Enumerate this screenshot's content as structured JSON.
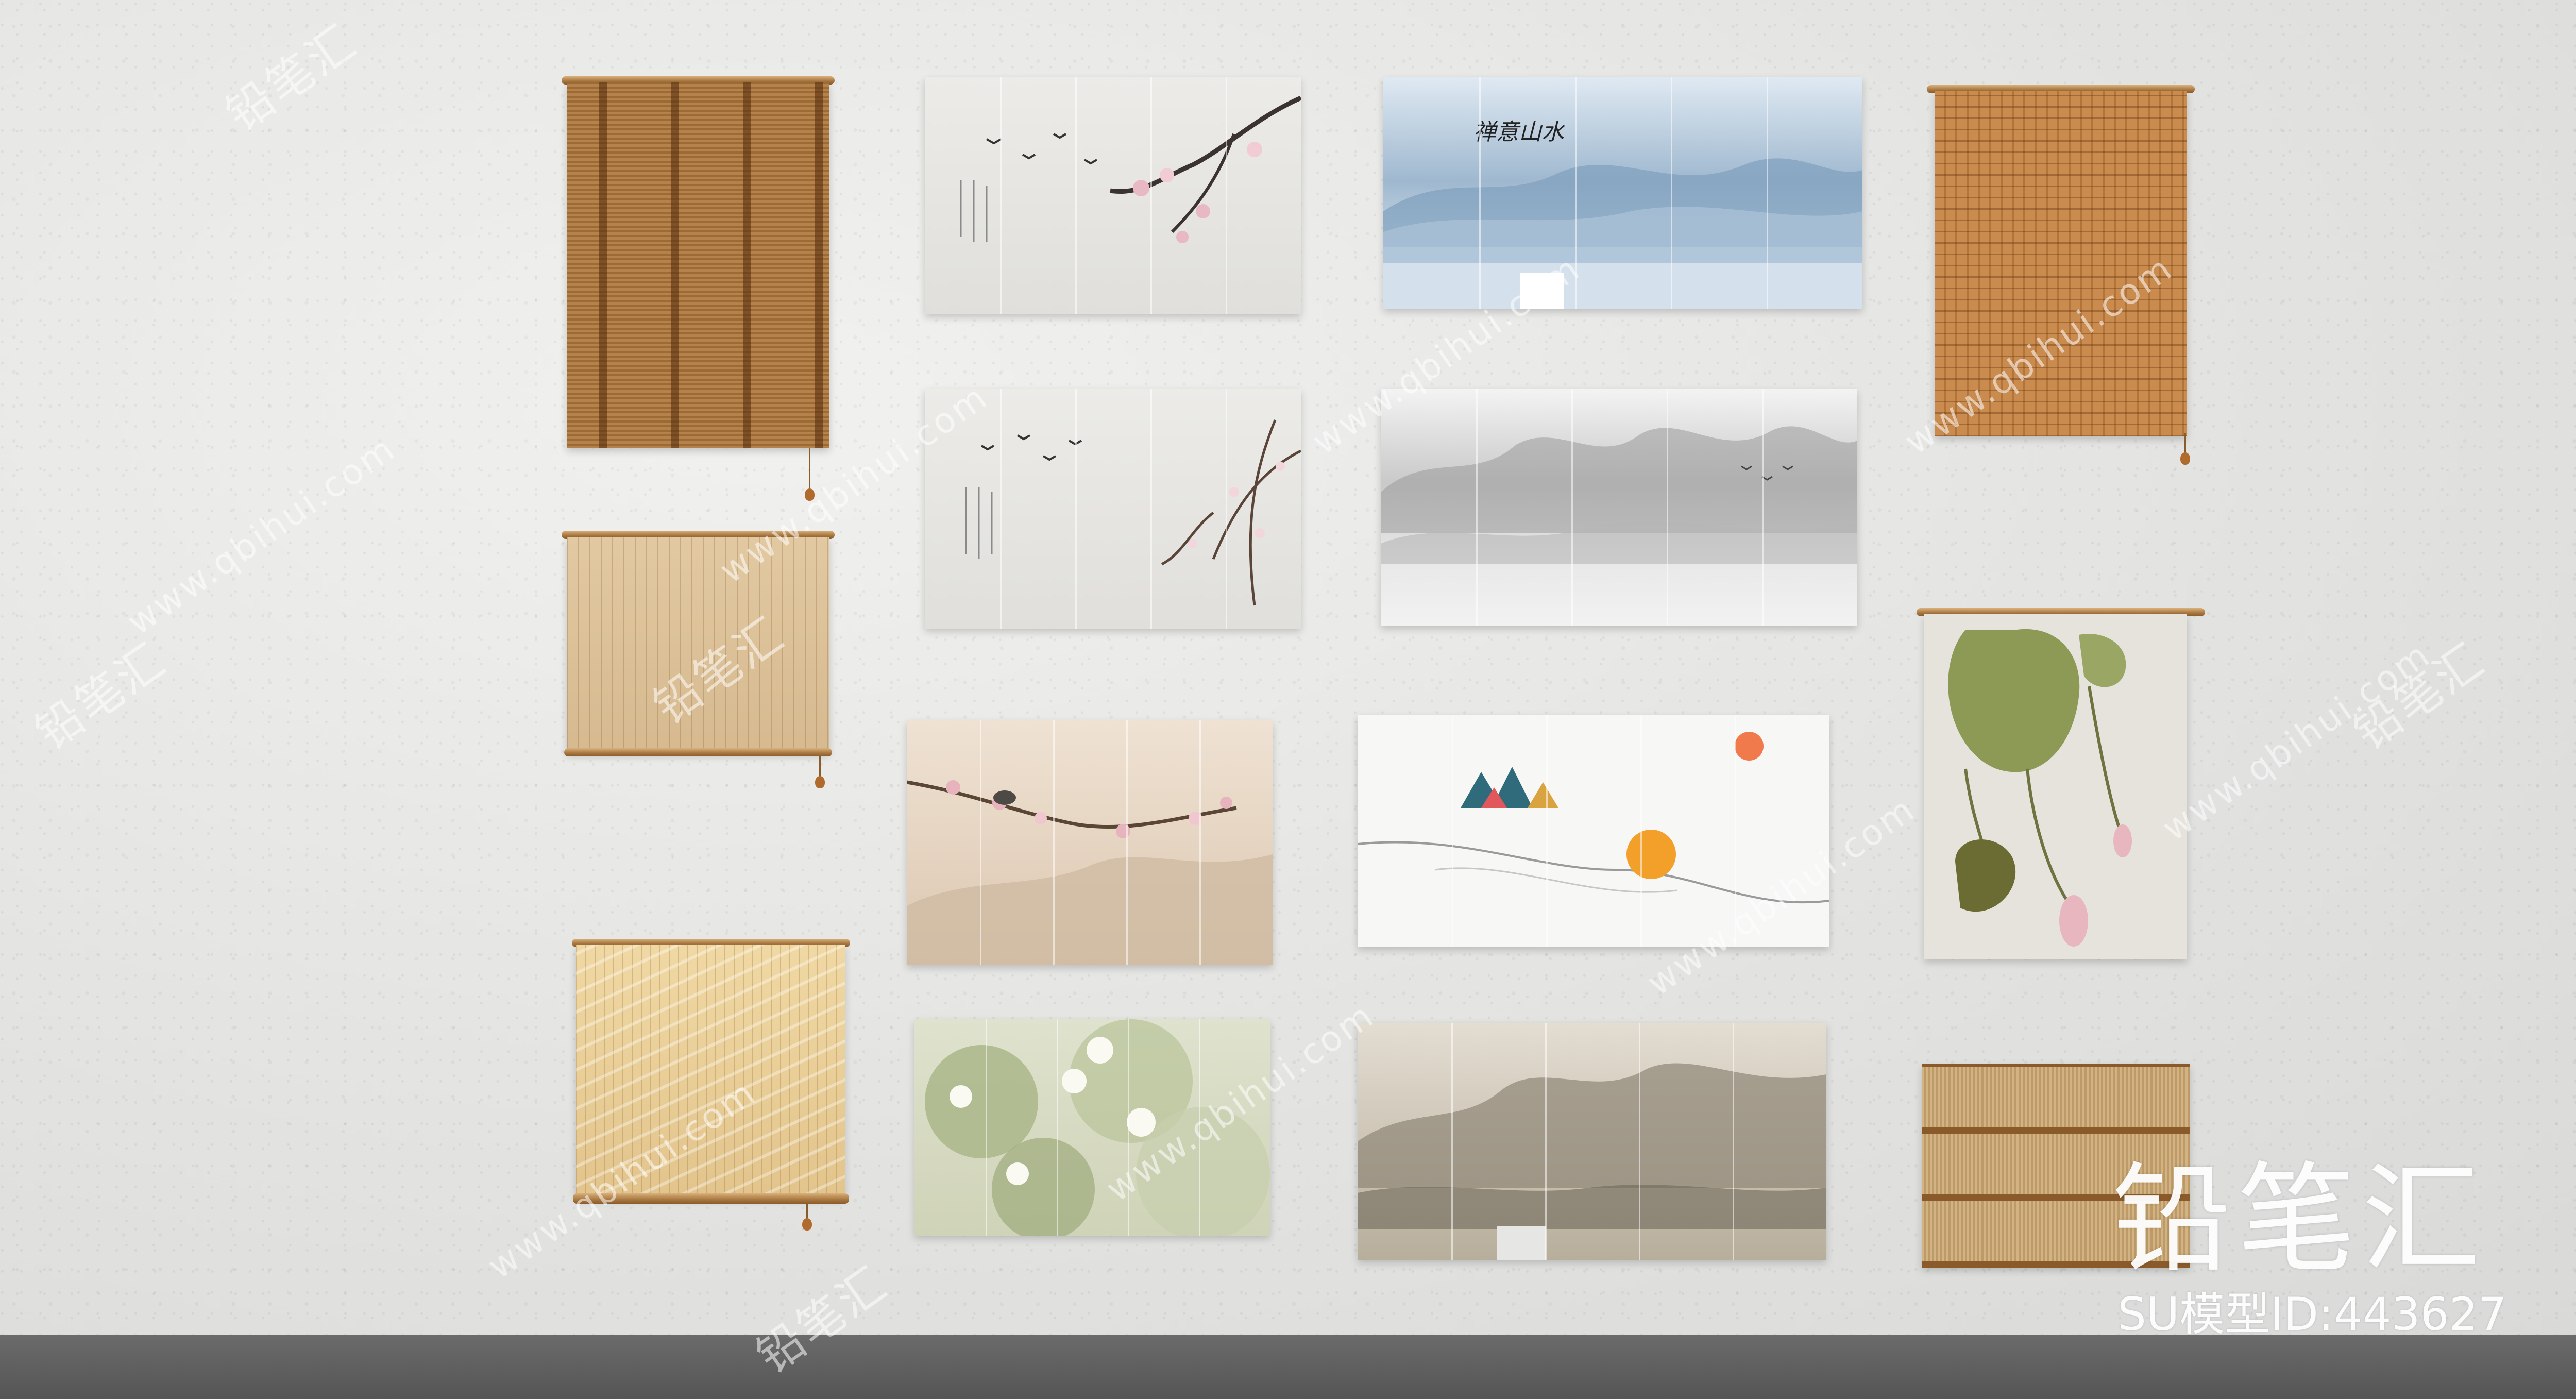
{
  "watermark": {
    "site_text": "www.qbihui.com",
    "brand_text": "铅笔汇"
  },
  "brand": {
    "logo_text": "铅笔汇",
    "model_id_text": "SU模型ID:443627"
  },
  "painting_text": {
    "mist_calligraphy": "禅意山水"
  },
  "colors": {
    "wall": "#e6e6e4",
    "floor": "#5f5f5f",
    "bamboo": "#b5824b",
    "watermark": "#ffffff"
  }
}
